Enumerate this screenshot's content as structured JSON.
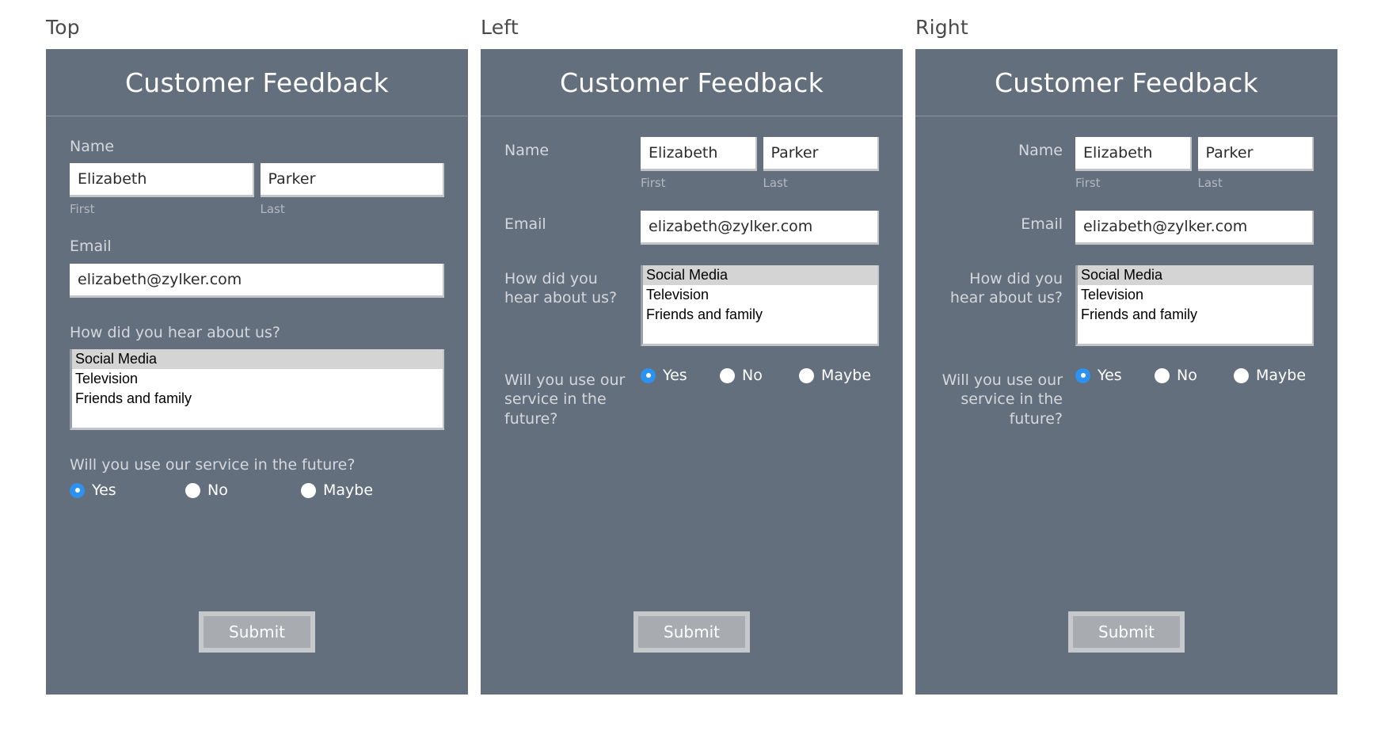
{
  "page": {
    "background": "#ffffff",
    "card_background": "#646f7d",
    "accent_color": "#2d91f0"
  },
  "columns": [
    {
      "caption": "Top",
      "layout": "top"
    },
    {
      "caption": "Left",
      "layout": "left"
    },
    {
      "caption": "Right",
      "layout": "right"
    }
  ],
  "form": {
    "title": "Customer Feedback",
    "name": {
      "label": "Name",
      "first": {
        "value": "Elizabeth",
        "sub_label": "First",
        "placeholder": "First"
      },
      "last": {
        "value": "Parker",
        "sub_label": "Last",
        "placeholder": "Last"
      }
    },
    "email": {
      "label": "Email",
      "value": "elizabeth@zylker.com",
      "placeholder": "Email"
    },
    "source": {
      "label": "How did you hear about us?",
      "label_wrapped": "How did you hear about us?",
      "options": [
        "Social Media",
        "Television",
        "Friends and family"
      ],
      "selected": "Social Media"
    },
    "future": {
      "label": "Will you use our service in the future?",
      "options": [
        "Yes",
        "No",
        "Maybe"
      ],
      "selected": "Yes"
    },
    "submit_label": "Submit"
  }
}
